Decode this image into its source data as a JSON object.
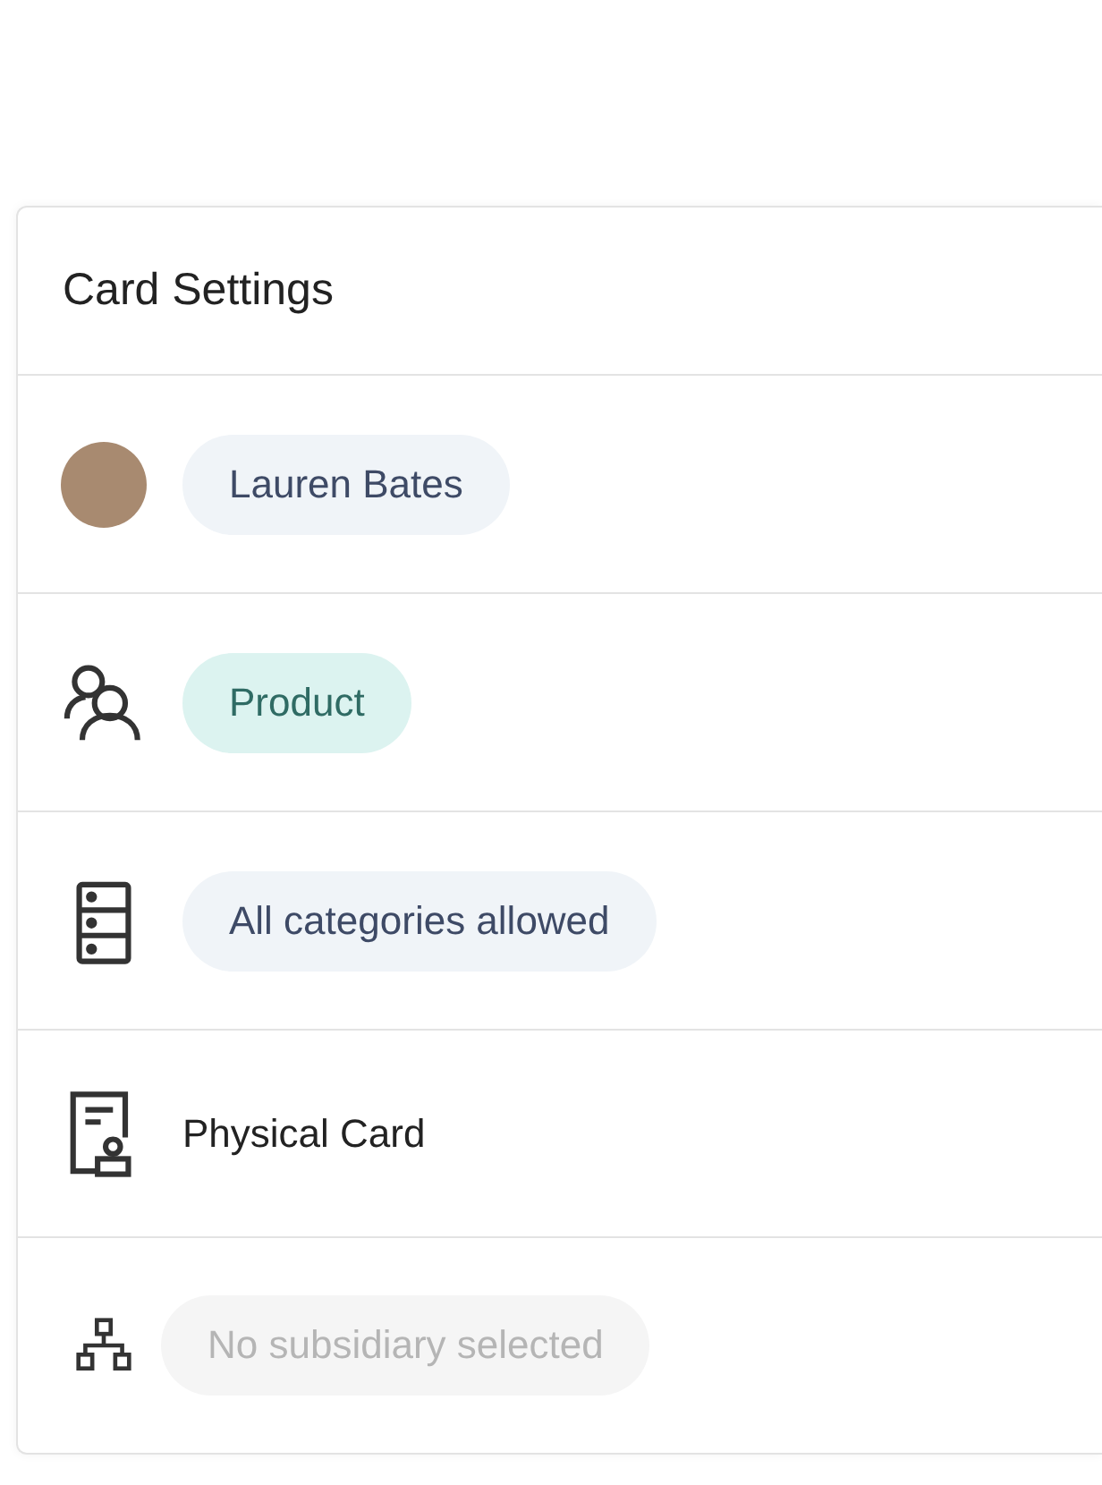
{
  "card": {
    "title": "Card Settings",
    "rows": [
      {
        "kind": "user",
        "disabled": false,
        "text": "Lauren Bates"
      },
      {
        "kind": "team",
        "disabled": false,
        "text": "Product"
      },
      {
        "kind": "categories",
        "disabled": false,
        "text": "All categories allowed"
      },
      {
        "kind": "card_type",
        "disabled": false,
        "text": "Physical Card"
      },
      {
        "kind": "subsidiary",
        "disabled": true,
        "text": "No subsidiary selected"
      }
    ]
  }
}
